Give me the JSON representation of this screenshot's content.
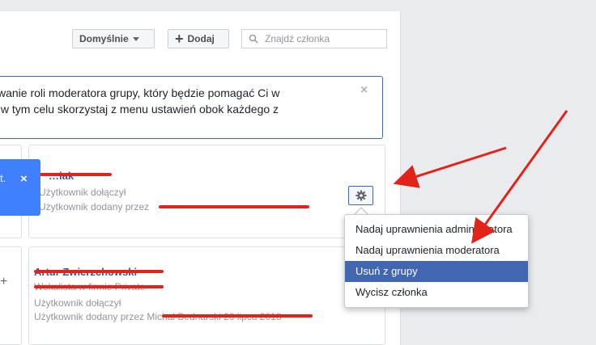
{
  "toolbar": {
    "default_label": "Domyślnie",
    "add_label": "Dodaj",
    "search_placeholder": "Znajdź członka"
  },
  "notice": {
    "text": "wanie roli moderatora grupy, który będzie pomagać Ci w\n w tym celu skorzystaj z menu ustawień obok każdego z",
    "close": "×"
  },
  "tooltip": {
    "text": "t.",
    "close": "×"
  },
  "members": [
    {
      "name": "…iak",
      "joined": "Użytkownik dołączył",
      "added_by": "Użytkownik dodany przez"
    },
    {
      "name": "Artur Zwierzchowski",
      "subtitle": "Wokalista w firmie Private",
      "joined": "Użytkownik dołączył",
      "added_by": "Użytkownik dodany przez Michał Bednarski 20 lipca 2018"
    }
  ],
  "dropdown": {
    "items": [
      "Nadaj uprawnienia administratora",
      "Nadaj uprawnienia moderatora",
      "Usuń z grupy",
      "Wycisz członka"
    ],
    "active_index": 2
  },
  "colors": {
    "accent": "#4267b2",
    "annotation_red": "#e2231a",
    "tooltip_blue": "#4080ff"
  },
  "icons": {
    "gear": "gear-icon",
    "search": "search-icon",
    "caret": "caret-down-icon",
    "plus": "plus-icon",
    "close": "close-icon"
  }
}
